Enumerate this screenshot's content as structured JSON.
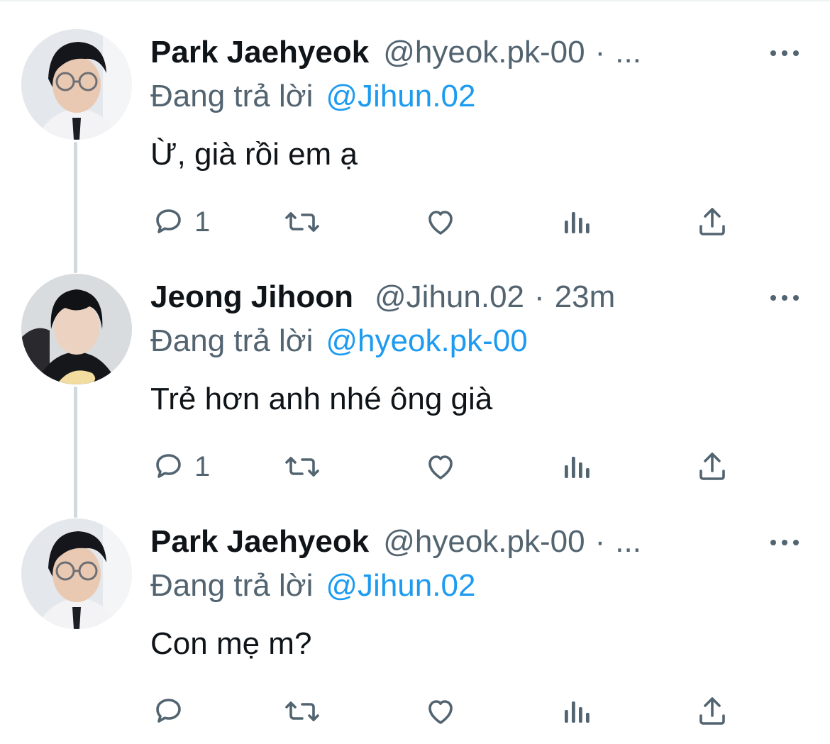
{
  "colors": {
    "text_primary": "#0f1419",
    "text_secondary": "#536471",
    "link_blue": "#1d9bf0",
    "thread_line": "#cfd9de"
  },
  "icons": {
    "reply": "speech-bubble-icon",
    "retweet": "retweet-arrows-icon",
    "like": "heart-icon",
    "views": "bar-chart-icon",
    "share": "share-upload-icon",
    "more": "ellipsis-icon"
  },
  "tweets": [
    {
      "name": "Park Jaehyeok",
      "handle": "@hyeok.pk-00",
      "separator": "·",
      "time": "...",
      "reply_prefix": "Đang trả lời",
      "reply_target": "@Jihun.02",
      "text": "Ừ, già rồi em ạ",
      "reply_count": "1"
    },
    {
      "name": "Jeong Jihoon",
      "handle": "@Jihun.02",
      "separator": "·",
      "time": "23m",
      "reply_prefix": "Đang trả lời",
      "reply_target": "@hyeok.pk-00",
      "text": "Trẻ hơn anh nhé ông già",
      "reply_count": "1"
    },
    {
      "name": "Park Jaehyeok",
      "handle": "@hyeok.pk-00",
      "separator": "·",
      "time": "...",
      "reply_prefix": "Đang trả lời",
      "reply_target": "@Jihun.02",
      "text": "Con mẹ m?",
      "reply_count": ""
    }
  ]
}
